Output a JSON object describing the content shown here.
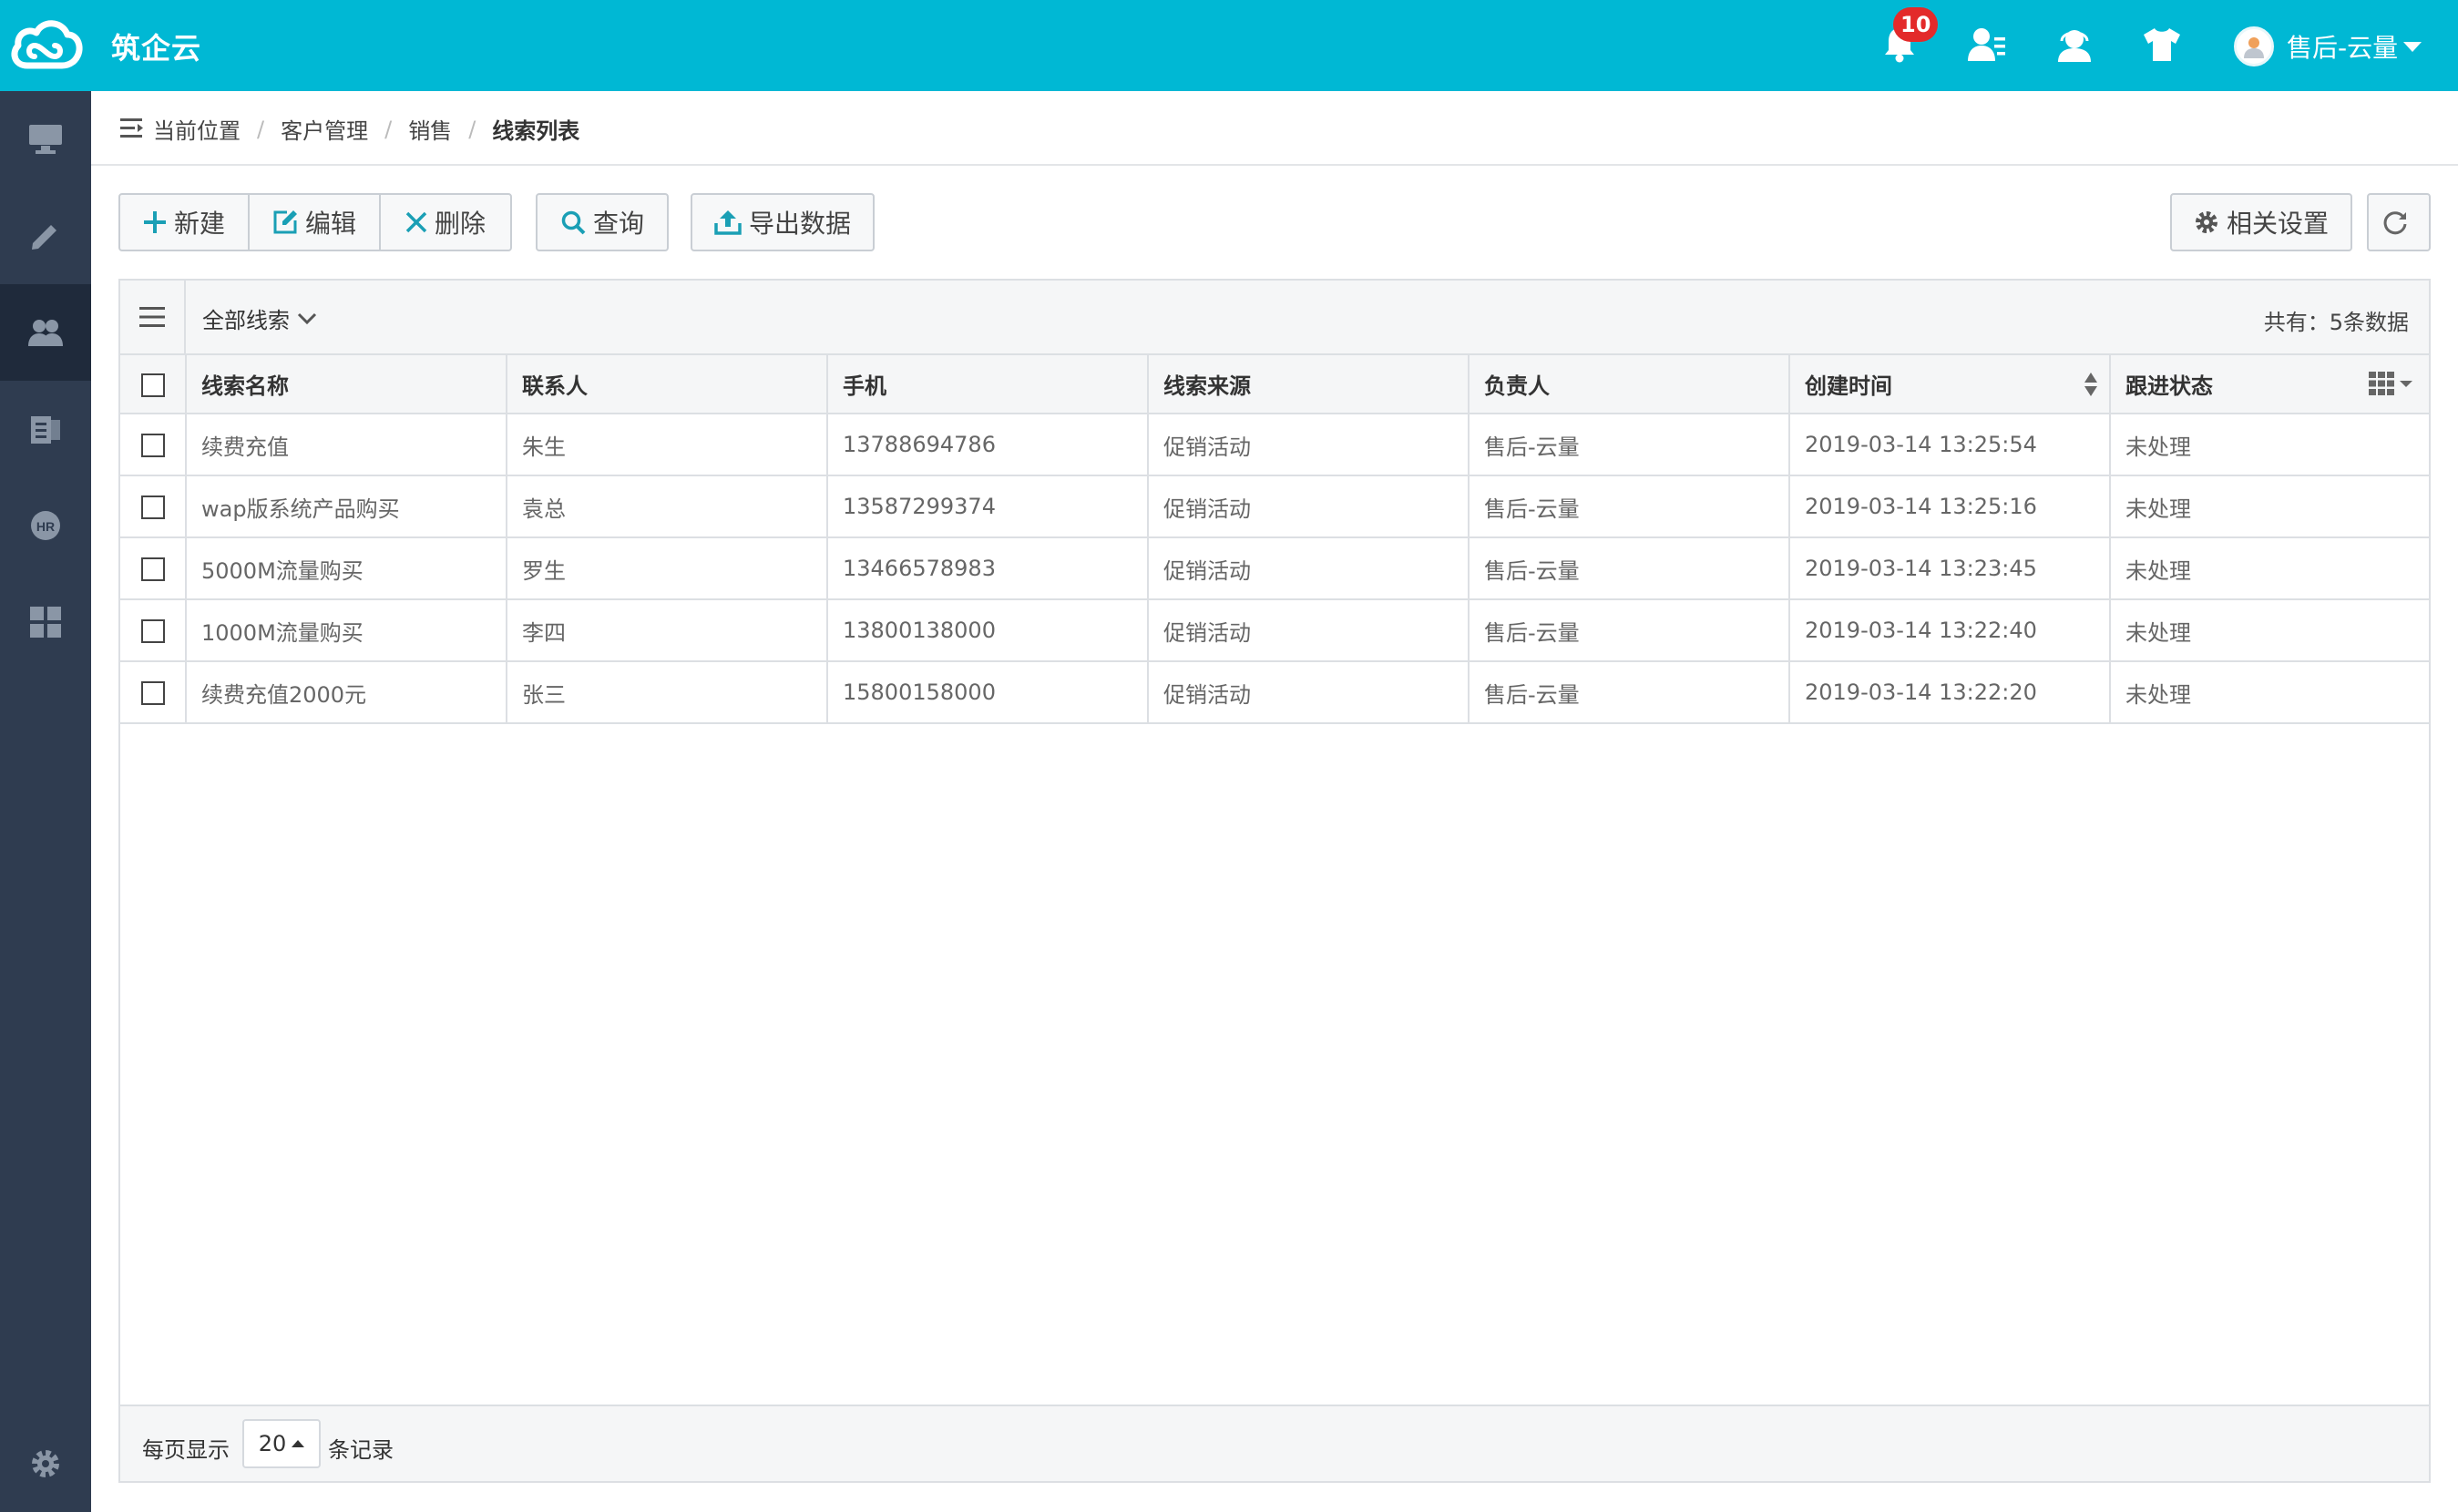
{
  "app": {
    "brand": "筑企云",
    "notification_count": "10"
  },
  "user": {
    "name": "售后-云量"
  },
  "breadcrumb": {
    "items": [
      "当前位置",
      "客户管理",
      "销售"
    ],
    "current": "线索列表"
  },
  "toolbar": {
    "new_label": "新建",
    "edit_label": "编辑",
    "delete_label": "删除",
    "query_label": "查询",
    "export_label": "导出数据",
    "settings_label": "相关设置"
  },
  "panel": {
    "filter_label": "全部线索",
    "total_text": "共有：5条数据"
  },
  "table": {
    "columns": [
      "线索名称",
      "联系人",
      "手机",
      "线索来源",
      "负责人",
      "创建时间",
      "跟进状态"
    ],
    "rows": [
      [
        "续费充值",
        "朱生",
        "13788694786",
        "促销活动",
        "售后-云量",
        "2019-03-14 13:25:54",
        "未处理"
      ],
      [
        "wap版系统产品购买",
        "袁总",
        "13587299374",
        "促销活动",
        "售后-云量",
        "2019-03-14 13:25:16",
        "未处理"
      ],
      [
        "5000M流量购买",
        "罗生",
        "13466578983",
        "促销活动",
        "售后-云量",
        "2019-03-14 13:23:45",
        "未处理"
      ],
      [
        "1000M流量购买",
        "李四",
        "13800138000",
        "促销活动",
        "售后-云量",
        "2019-03-14 13:22:40",
        "未处理"
      ],
      [
        "续费充值2000元",
        "张三",
        "15800158000",
        "促销活动",
        "售后-云量",
        "2019-03-14 13:22:20",
        "未处理"
      ]
    ]
  },
  "pager": {
    "prefix": "每页显示",
    "page_size": "20",
    "suffix": "条记录"
  },
  "colors": {
    "topbar": "#00b8d4",
    "sidebar": "#2f3c50",
    "sidebar_active": "#1f2a3b",
    "link": "#2f86c8",
    "badge": "#e32a2a",
    "icon_accent": "#1a9fb5"
  }
}
